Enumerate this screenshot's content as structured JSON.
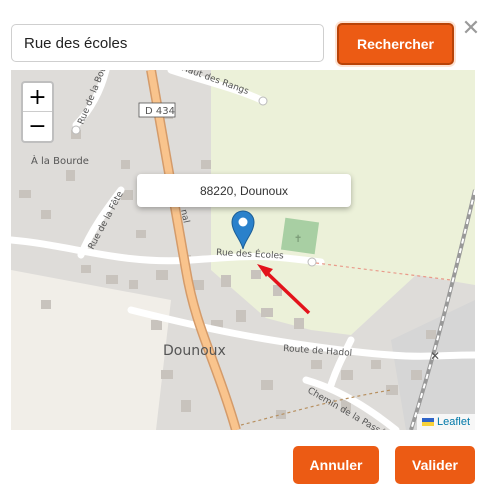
{
  "search": {
    "value": "Rue des écoles"
  },
  "buttons": {
    "search": "Rechercher",
    "cancel": "Annuler",
    "validate": "Valider",
    "close": "✕"
  },
  "map": {
    "zoom_in": "+",
    "zoom_out": "−",
    "popup": "88220, Dounoux",
    "attribution": "Leaflet",
    "labels": {
      "road_d434": "D 434",
      "a_la_bourde": "À la Bourde",
      "rue_de_la_bourde": "Rue de la Bourde",
      "rue_de_la_fete": "Rue de la Fête",
      "haut_des_rangs": "Haut des Rangs",
      "rue_des_ecoles": "Rue des Écoles",
      "dounoux": "Dounoux",
      "route_de_hadol": "Route de Hadol",
      "chemin_de_la_passee": "Chemin de la Passée",
      "canal_fragment": "nal"
    }
  },
  "colors": {
    "accent": "#ec5b14",
    "marker": "#2a81cb"
  }
}
